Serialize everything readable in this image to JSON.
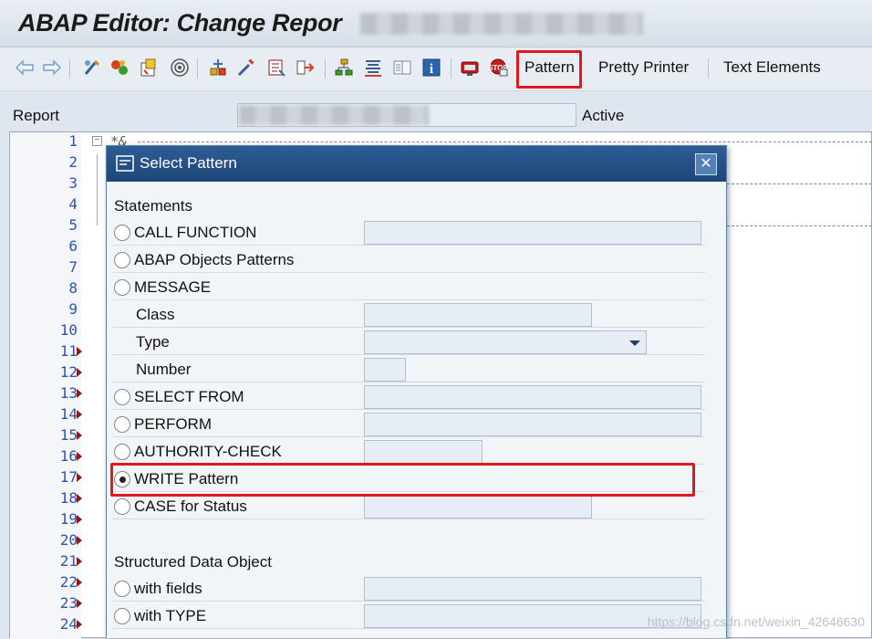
{
  "window": {
    "title": "ABAP Editor: Change Repor"
  },
  "toolbar": {
    "pattern_label": "Pattern",
    "pretty_printer_label": "Pretty Printer",
    "text_elements_label": "Text Elements",
    "icons": [
      "back-icon",
      "forward-icon",
      "other-object-icon",
      "display-change-icon",
      "active-inactive-icon",
      "activate-icon",
      "check-icon",
      "test-icon",
      "where-used-icon",
      "enhance-icon",
      "object-list-icon",
      "navigation-window-icon",
      "display-object-list-icon",
      "help-icon",
      "breakpoint-icon",
      "external-breakpoint-icon"
    ]
  },
  "report": {
    "label": "Report",
    "status": "Active"
  },
  "editor": {
    "line_numbers": [
      "1",
      "2",
      "3",
      "4",
      "5",
      "6",
      "7",
      "8",
      "9",
      "10",
      "11",
      "12",
      "13",
      "14",
      "15",
      "16",
      "17",
      "18",
      "19",
      "20",
      "21",
      "22",
      "23",
      "24"
    ],
    "first_line": "*&"
  },
  "dialog": {
    "title": "Select Pattern",
    "close_symbol": "✕",
    "statements_heading": "Statements",
    "options": {
      "call_function": "CALL FUNCTION",
      "abap_objects": "ABAP Objects Patterns",
      "message": "MESSAGE",
      "message_class": "Class",
      "message_type": "Type",
      "message_number": "Number",
      "select_from": "SELECT FROM",
      "perform": "PERFORM",
      "authority_check": "AUTHORITY-CHECK",
      "write_pattern": "WRITE Pattern",
      "case_status": "CASE for Status"
    },
    "selected": "WRITE Pattern",
    "structured_heading": "Structured Data Object",
    "structured_options": {
      "with_fields": "with fields",
      "with_type": "with TYPE"
    }
  },
  "watermark": "https://blog.csdn.net/weixin_42646630"
}
